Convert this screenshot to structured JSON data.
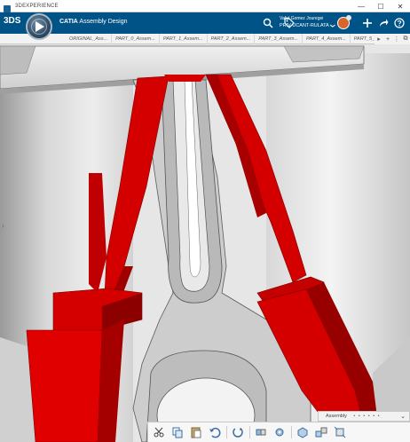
{
  "window": {
    "title": "3DEXPERIENCE",
    "minimize": "—",
    "maximize": "☐",
    "close": "✕"
  },
  "banner": {
    "brand": "3DS",
    "app_bold": "CATIA",
    "app_rest": " Assembly Design",
    "user_name": "Vafet Gomez Jouregei",
    "user_role": "PRIV-UCANT-RULATA",
    "role_caret": "❯"
  },
  "tabs": [
    "ORIGINAL_Ass...",
    "PART_0_Assem...",
    "PART_1_Assem...",
    "PART_2_Assem...",
    "PART_3_Assem...",
    "PART_4_Assem...",
    "PART_5_Assem..."
  ],
  "tabs_tools": {
    "expand": "▸",
    "add": "+",
    "more": "⋮",
    "popout": "⧉"
  },
  "viewport": {
    "left_arrow": "›"
  },
  "section": {
    "label": "Assembly",
    "dots": "• • • • • •",
    "caret": "⌄"
  },
  "colors": {
    "banner": "#005386",
    "part_red": "#d40000",
    "part_dark_red": "#8c0000",
    "grey_body": "#cfcfcf"
  },
  "icons": {
    "search": "search-icon",
    "tag": "tag-icon",
    "add": "plus-icon",
    "share": "share-icon",
    "help": "help-icon"
  }
}
